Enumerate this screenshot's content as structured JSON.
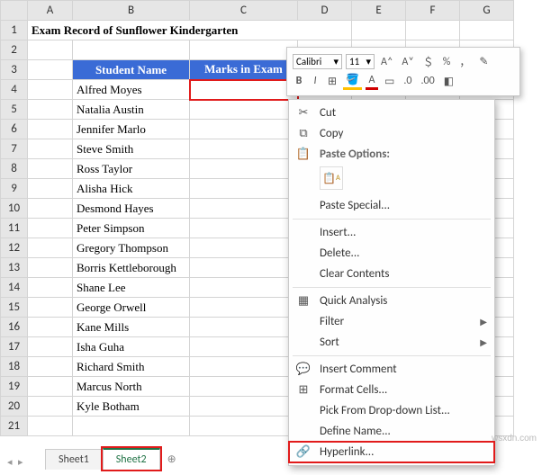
{
  "title": "Exam Record of Sunflower Kindergarten",
  "columns": [
    "A",
    "B",
    "C",
    "D",
    "E",
    "F",
    "G"
  ],
  "rows": [
    "1",
    "2",
    "3",
    "4",
    "5",
    "6",
    "7",
    "8",
    "9",
    "10",
    "11",
    "12",
    "13",
    "14",
    "15",
    "16",
    "17",
    "18",
    "19",
    "20",
    "21"
  ],
  "headers": {
    "student": "Student Name",
    "marks": "Marks in Exam"
  },
  "students": [
    "Alfred Moyes",
    "Natalia Austin",
    "Jennifer Marlo",
    "Steve Smith",
    "Ross Taylor",
    "Alisha Hick",
    "Desmond Hayes",
    "Peter Simpson",
    "Gregory Thompson",
    "Borris Kettleborough",
    "Shane Lee",
    "George Orwell",
    "Kane Mills",
    "Isha Guha",
    "Richard Smith",
    "Marcus North",
    "Kyle Botham"
  ],
  "mini_toolbar": {
    "font": "Calibri",
    "size": "11",
    "btns_row1": [
      "A˄",
      "A˅",
      "＄",
      "%",
      "，"
    ],
    "bold": "B",
    "italic": "I",
    "fill": "A",
    "font_color": "A",
    "border": "⊞",
    "merge": "⇔",
    "inc": ".00",
    "dec": ".0",
    "fmt": "✎"
  },
  "ctx": {
    "cut": "Cut",
    "copy": "Copy",
    "paste_options": "Paste Options:",
    "paste_special": "Paste Special...",
    "insert": "Insert...",
    "delete": "Delete...",
    "clear": "Clear Contents",
    "quick": "Quick Analysis",
    "filter": "Filter",
    "sort": "Sort",
    "comment": "Insert Comment",
    "format": "Format Cells...",
    "dropdown": "Pick From Drop-down List...",
    "define": "Define Name...",
    "hyperlink": "Hyperlink..."
  },
  "tabs": {
    "sheet1": "Sheet1",
    "sheet2": "Sheet2",
    "plus": "⊕"
  },
  "watermark": "wsxdn.com"
}
